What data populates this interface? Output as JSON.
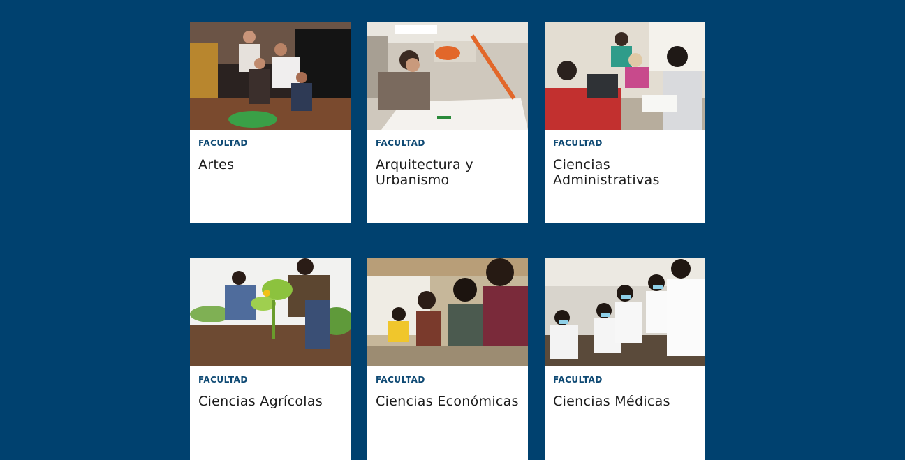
{
  "faculties": [
    {
      "eyebrow": "FACULTAD",
      "title": "Artes",
      "photo": "theater-performers-photo"
    },
    {
      "eyebrow": "FACULTAD",
      "title": "Arquitectura y Urbanismo",
      "photo": "architect-drafting-photo"
    },
    {
      "eyebrow": "FACULTAD",
      "title": "Ciencias Administrativas",
      "photo": "office-meeting-photo"
    },
    {
      "eyebrow": "FACULTAD",
      "title": "Ciencias Agrícolas",
      "photo": "planting-seedlings-photo"
    },
    {
      "eyebrow": "FACULTAD",
      "title": "Ciencias Económicas",
      "photo": "classroom-students-photo"
    },
    {
      "eyebrow": "FACULTAD",
      "title": "Ciencias Médicas",
      "photo": "medical-lab-photo"
    }
  ],
  "colors": {
    "background": "#00416f",
    "eyebrow": "#0f4a74",
    "title": "#1b1b1b",
    "card": "#ffffff"
  }
}
